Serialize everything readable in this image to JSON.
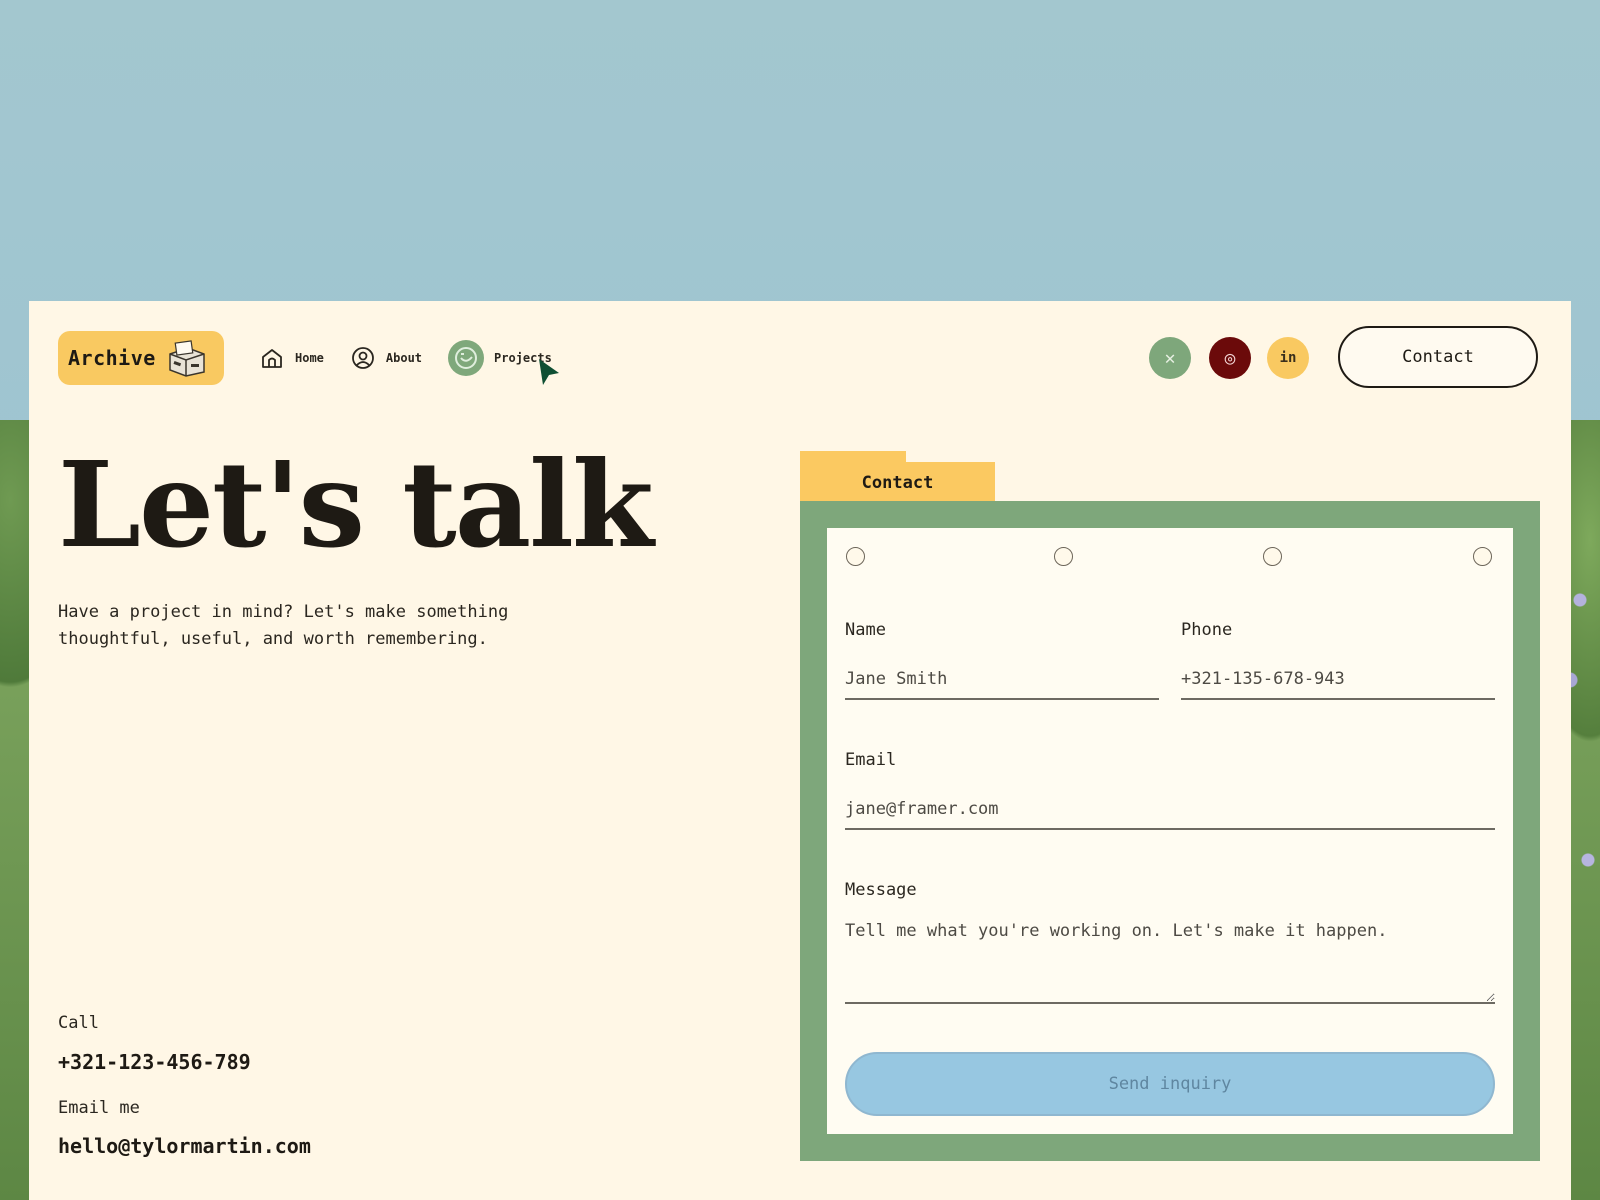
{
  "nav": {
    "logo": "Archive",
    "items": [
      {
        "label": "Home",
        "icon": "house-icon",
        "active": false
      },
      {
        "label": "About",
        "icon": "user-icon",
        "active": false
      },
      {
        "label": "Projects",
        "icon": "smiley-icon",
        "active": true
      }
    ],
    "social": [
      {
        "name": "x",
        "glyph": "✕",
        "bg": "#7ea77b",
        "fg": "#e8f0e3"
      },
      {
        "name": "instagram",
        "glyph": "◎",
        "bg": "#6b0a0a",
        "fg": "#f4d6d6"
      },
      {
        "name": "linkedin",
        "glyph": "in",
        "bg": "#f9c961",
        "fg": "#3a2f1c"
      }
    ],
    "contact_label": "Contact"
  },
  "hero": {
    "title": "Let's talk",
    "intro": "Have a project in mind? Let's make something thoughtful, useful, and worth remembering."
  },
  "contact_info": {
    "call_label": "Call",
    "phone": "+321-123-456-789",
    "email_label": "Email me",
    "email": "hello@tylormartin.com"
  },
  "form": {
    "tab_label": "Contact",
    "name_label": "Name",
    "name_placeholder": "Jane Smith",
    "phone_label": "Phone",
    "phone_placeholder": "+321-135-678-943",
    "email_label": "Email",
    "email_placeholder": "jane@framer.com",
    "message_label": "Message",
    "message_placeholder": "Tell me what you're working on. Let's make it happen.",
    "submit_label": "Send inquiry"
  },
  "colors": {
    "panel": "#fff7e6",
    "accent_yellow": "#f9c961",
    "accent_green": "#7ea77b",
    "button_blue": "#97c7e1"
  }
}
